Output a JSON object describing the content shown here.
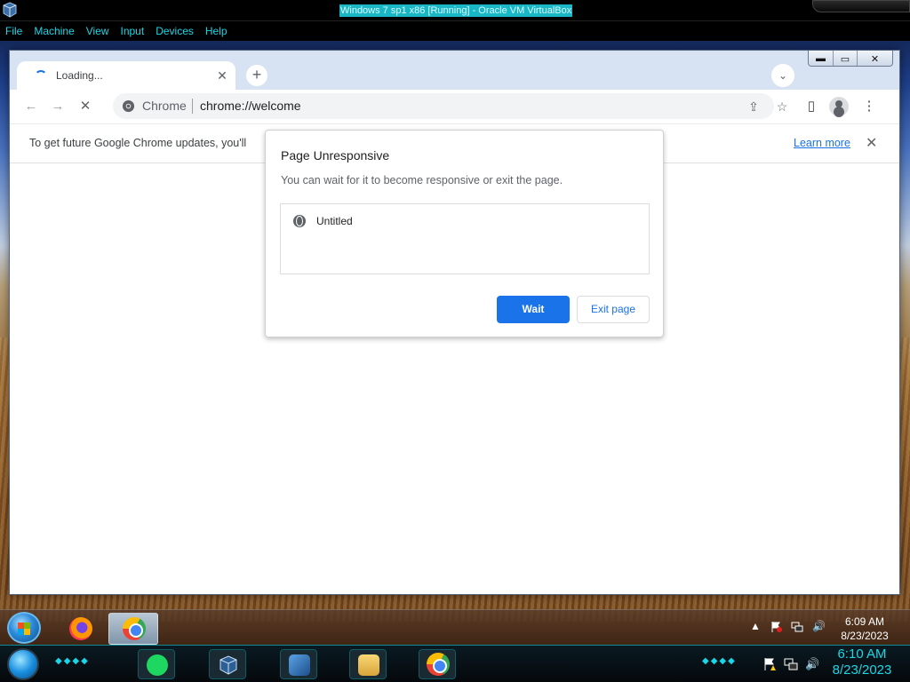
{
  "host": {
    "window_title": "Windows 7 sp1 x86 [Running] - Oracle VM VirtualBox",
    "menu": [
      "File",
      "Machine",
      "View",
      "Input",
      "Devices",
      "Help"
    ],
    "clock_time": "6:10 AM",
    "clock_date": "8/23/2023",
    "accent_color": "#19d7e6"
  },
  "chrome": {
    "tab_title": "Loading...",
    "omnibox_chip": "Chrome",
    "omnibox_url": "chrome://welcome",
    "infobar_text": "To get future Google Chrome updates, you'll",
    "infobar_link": "Learn more",
    "window_controls": {
      "minimize": "▬",
      "maximize": "▭",
      "close": "✕"
    }
  },
  "dialog": {
    "title": "Page Unresponsive",
    "body": "You can wait for it to become responsive or exit the page.",
    "page_item": "Untitled",
    "wait_label": "Wait",
    "exit_label": "Exit page",
    "primary_color": "#1a73e8"
  },
  "guest_taskbar": {
    "clock_time": "6:09 AM",
    "clock_date": "8/23/2023"
  },
  "icons": {
    "back": "←",
    "forward": "→",
    "stop": "✕",
    "new_tab": "+",
    "tab_search": "⌄",
    "tab_close": "✕",
    "share": "⇪",
    "star": "☆",
    "side_panel": "▯",
    "menu": "⋮",
    "info_close": "✕",
    "tray_up": "▲",
    "volume": "🔊"
  }
}
